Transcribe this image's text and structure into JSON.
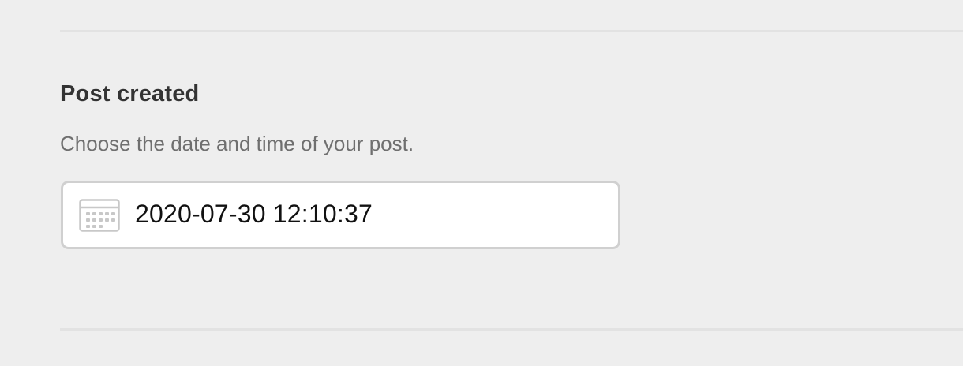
{
  "section": {
    "title": "Post created",
    "description": "Choose the date and time of your post."
  },
  "date_field": {
    "value": "2020-07-30 12:10:37",
    "icon": "calendar-icon"
  },
  "colors": {
    "background": "#eeeeee",
    "divider": "#e2e2e2",
    "field_border": "#d0d0d0",
    "field_background": "#ffffff",
    "title_text": "#333333",
    "description_text": "#6f6f6f",
    "icon_gray": "#c8c8c8"
  }
}
